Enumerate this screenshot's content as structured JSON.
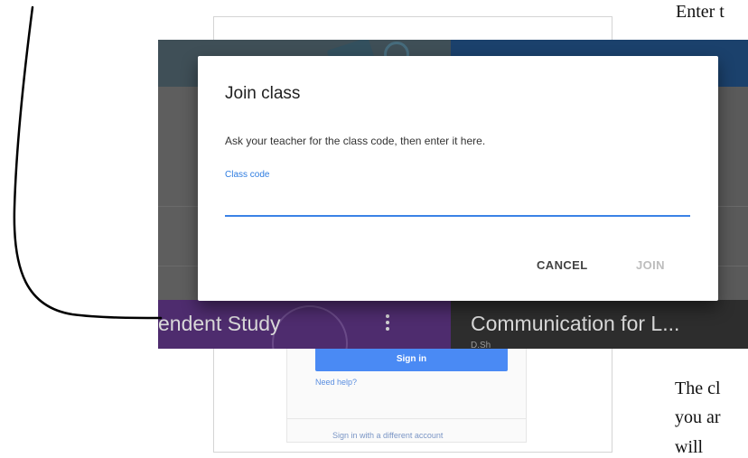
{
  "document": {
    "text_top": "Enter t",
    "text_bottom_1": "The cl",
    "text_bottom_2": "you ar",
    "text_bottom_3": "will"
  },
  "background_page": {
    "sign_in_button": "Sign in",
    "need_help_link": "Need help?",
    "different_account_link": "Sign in with a different account"
  },
  "classes": {
    "left_tile_title": "endent Study",
    "right_tile_title": "Communication for L...",
    "right_tile_subtitle": "D.Sh"
  },
  "dialog": {
    "title": "Join class",
    "description": "Ask your teacher for the class code, then enter it here.",
    "field_label": "Class code",
    "field_value": "",
    "cancel_label": "CANCEL",
    "join_label": "JOIN"
  },
  "icons": {
    "tile_menu": "more-vert-icon"
  },
  "colors": {
    "accent": "#3b82e6",
    "purple_tile": "#4e2c6e",
    "join_disabled": "#bdbdbd"
  }
}
